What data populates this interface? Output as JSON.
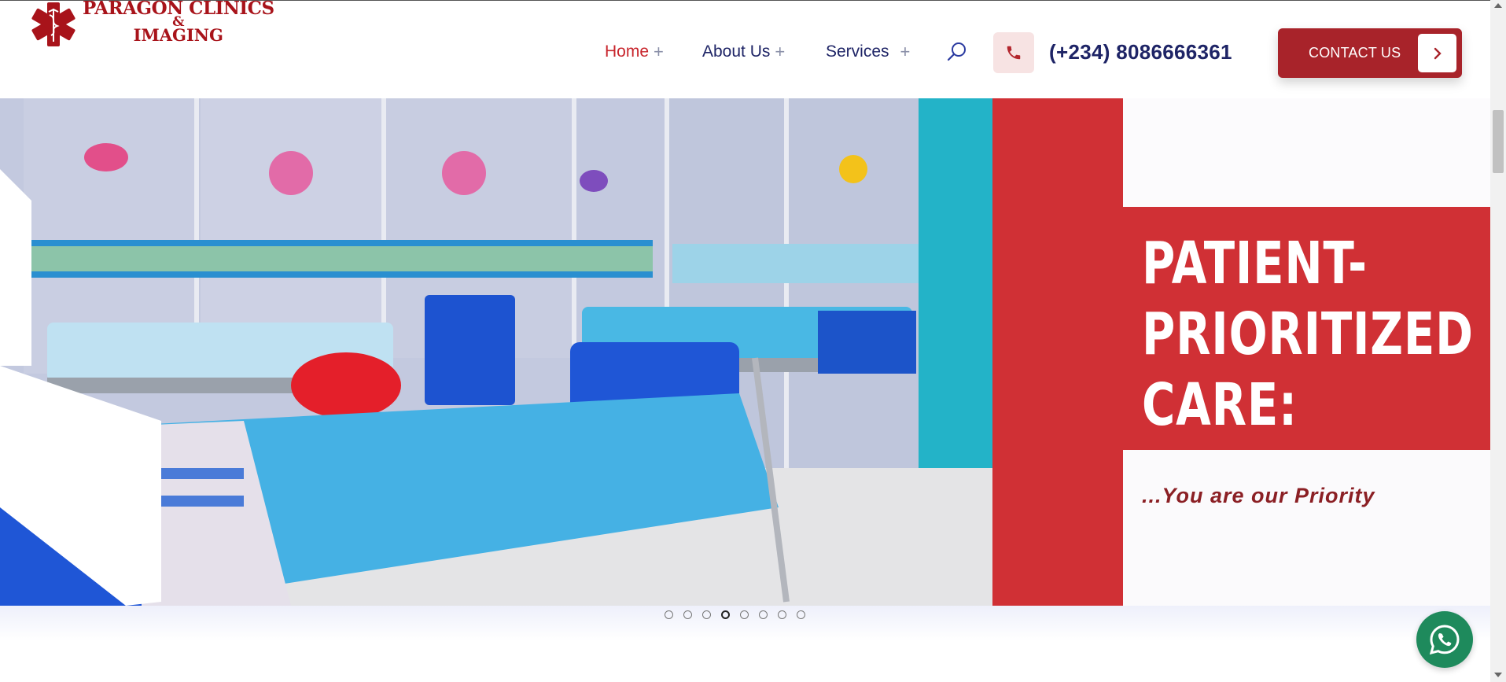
{
  "brand": {
    "line1": "PARAGON CLINICS",
    "line2": "&",
    "line3": "IMAGING",
    "color": "#a8131a"
  },
  "nav": {
    "items": [
      {
        "label": "Home",
        "active": true
      },
      {
        "label": "About Us",
        "active": false
      },
      {
        "label": "Services",
        "active": false
      }
    ]
  },
  "header": {
    "phone": "(+234) 8086666361",
    "contact_label": "CONTACT US"
  },
  "hero": {
    "headline_1": "PATIENT-",
    "headline_2": "PRIORITIZED",
    "headline_3": "CARE:",
    "tagline": "...You are our Priority",
    "slides_total": 8,
    "active_slide_index": 3
  },
  "colors": {
    "accent_red": "#c8252c",
    "navy": "#1e2466",
    "button_red": "#a8232a",
    "whatsapp_green": "#1e8a5c"
  },
  "icons": {
    "search": "search-icon",
    "phone": "phone-icon",
    "chevron": "chevron-right-icon",
    "whatsapp": "whatsapp-icon"
  }
}
